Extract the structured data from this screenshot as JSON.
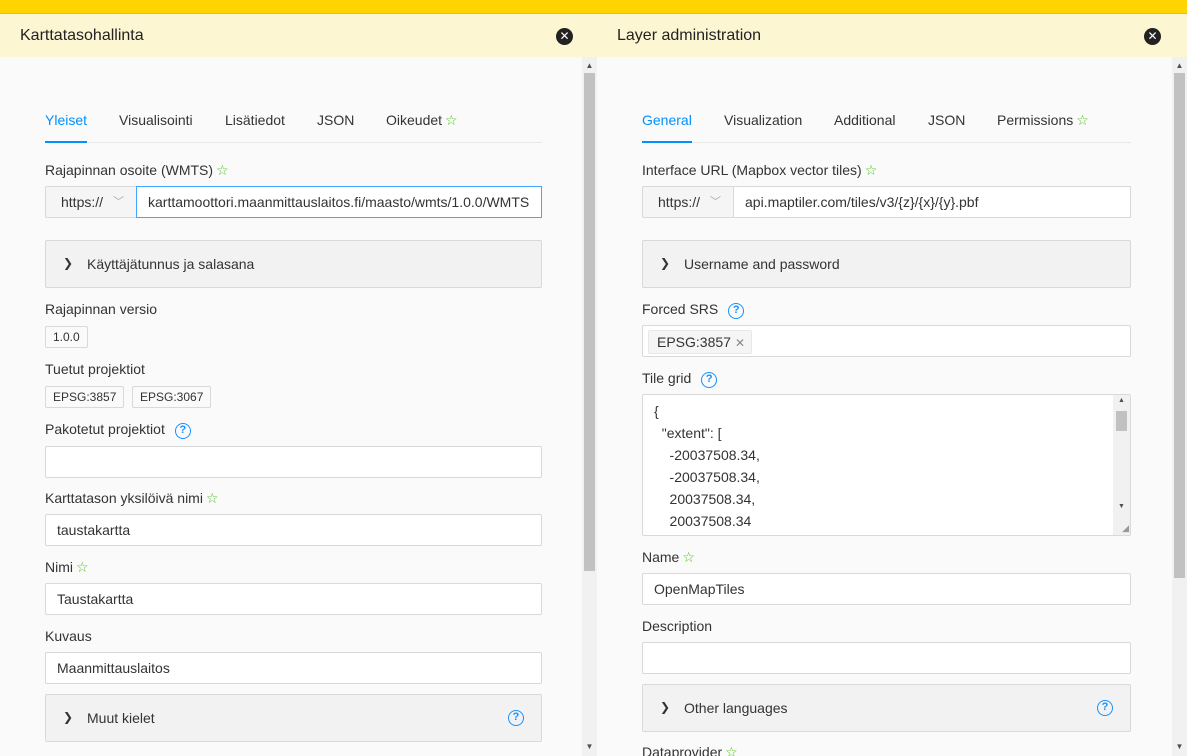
{
  "left": {
    "title": "Karttatasohallinta",
    "tabs": [
      {
        "label": "Yleiset",
        "active": true
      },
      {
        "label": "Visualisointi"
      },
      {
        "label": "Lisätiedot"
      },
      {
        "label": "JSON"
      },
      {
        "label": "Oikeudet",
        "star": true
      }
    ],
    "interface_url_label": "Rajapinnan osoite (WMTS)",
    "protocol": "https://",
    "interface_url_value": "karttamoottori.maanmittauslaitos.fi/maasto/wmts/1.0.0/WMTS",
    "credentials_label": "Käyttäjätunnus ja salasana",
    "version_label": "Rajapinnan versio",
    "version_value": "1.0.0",
    "projections_label": "Tuetut projektiot",
    "projections": [
      "EPSG:3857",
      "EPSG:3067"
    ],
    "forced_projections_label": "Pakotetut projektiot",
    "forced_projections_value": "",
    "unique_name_label": "Karttatason yksilöivä nimi",
    "unique_name_value": "taustakartta",
    "name_label": "Nimi",
    "name_value": "Taustakartta",
    "description_label": "Kuvaus",
    "description_value": "Maanmittauslaitos",
    "other_languages_label": "Muut kielet"
  },
  "right": {
    "title": "Layer administration",
    "tabs": [
      {
        "label": "General",
        "active": true
      },
      {
        "label": "Visualization"
      },
      {
        "label": "Additional"
      },
      {
        "label": "JSON"
      },
      {
        "label": "Permissions",
        "star": true
      }
    ],
    "interface_url_label": "Interface URL (Mapbox vector tiles)",
    "protocol": "https://",
    "interface_url_value": "api.maptiler.com/tiles/v3/{z}/{x}/{y}.pbf",
    "credentials_label": "Username and password",
    "forced_srs_label": "Forced SRS",
    "forced_srs_tag": "EPSG:3857",
    "tile_grid_label": "Tile grid",
    "tile_grid_lines": [
      "{",
      "  \"extent\": [",
      "    -20037508.34,",
      "    -20037508.34,",
      "    20037508.34,",
      "    20037508.34"
    ],
    "name_label": "Name",
    "name_value": "OpenMapTiles",
    "description_label": "Description",
    "description_value": "",
    "other_languages_label": "Other languages",
    "dataprovider_label": "Dataprovider"
  },
  "icons": {
    "close": "close-circle-icon",
    "help": "question-circle-icon",
    "star": "star-outline-icon",
    "expand": "chevron-right-icon",
    "select": "chevron-down-icon"
  },
  "colors": {
    "topbar": "#ffd400",
    "header": "#fdf6d3",
    "accent": "#0091ff",
    "star": "#52c41a",
    "help": "#1890ff"
  }
}
